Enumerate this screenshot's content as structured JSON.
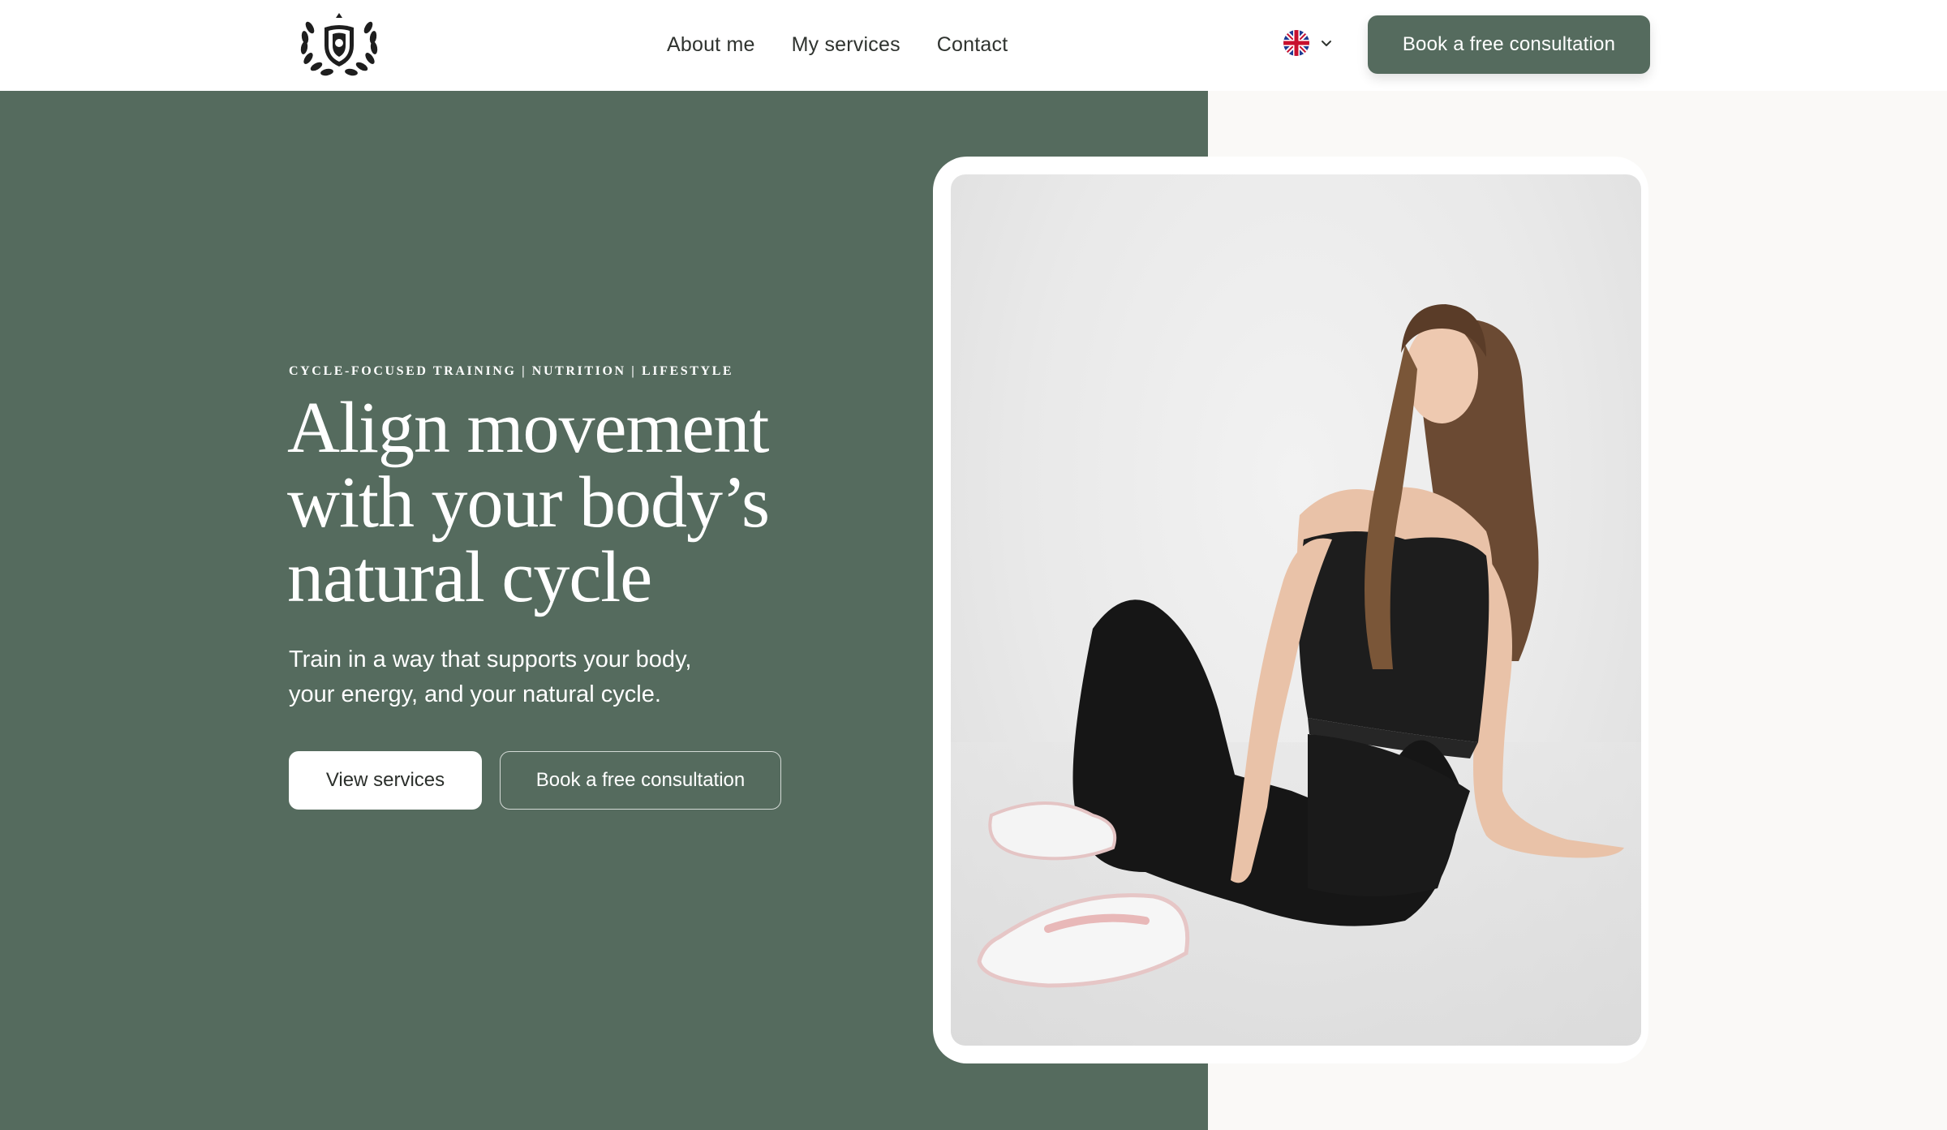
{
  "header": {
    "logo_name": "laurel-shield-logo",
    "nav": [
      {
        "label": "About me"
      },
      {
        "label": "My services"
      },
      {
        "label": "Contact"
      }
    ],
    "language_icon": "uk-flag-icon",
    "cta_label": "Book a free consultation"
  },
  "hero": {
    "eyebrow": "CYCLE-FOCUSED TRAINING | NUTRITION | LIFESTYLE",
    "headline_lines": [
      "Align movement",
      "with your body’s",
      "natural cycle"
    ],
    "subtext_lines": [
      "Train in a way that supports your body,",
      "your energy, and your natural cycle."
    ],
    "primary_button": "View services",
    "secondary_button": "Book a free consultation"
  },
  "photo": {
    "subject": "woman-in-black-activewear-seated-portrait"
  },
  "colors": {
    "brand_green": "#556b5e",
    "page_bg": "#faf9f7",
    "white": "#ffffff"
  }
}
